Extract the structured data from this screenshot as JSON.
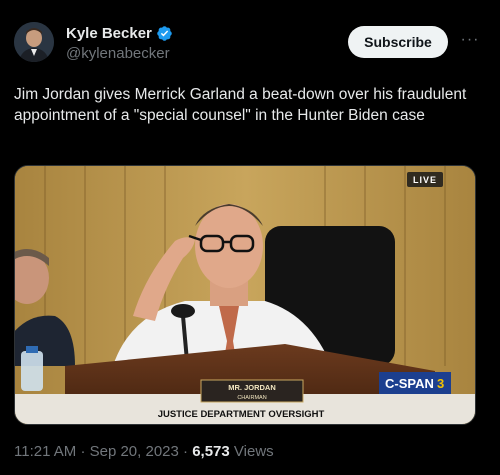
{
  "author": {
    "display_name": "Kyle Becker",
    "handle": "@kylenabecker"
  },
  "actions": {
    "subscribe_label": "Subscribe",
    "more_label": "···"
  },
  "tweet": {
    "text": "Jim Jordan gives Merrick Garland a beat-down over his fraudulent appointment of a \"special counsel\" in the Hunter Biden case"
  },
  "video": {
    "live_badge": "LIVE",
    "nameplate_line1": "MR. JORDAN",
    "nameplate_line2": "CHAIRMAN",
    "chyron": "JUSTICE DEPARTMENT OVERSIGHT",
    "network_logo_a": "C-SPAN",
    "network_logo_b": "3"
  },
  "meta": {
    "time": "11:21 AM",
    "date": "Sep 20, 2023",
    "views_count": "6,573",
    "views_label": "Views",
    "separator": "·"
  },
  "colors": {
    "verified": "#1d9bf0",
    "curtain": "#b8964d",
    "cspan_blue": "#1c3f8f",
    "cspan_yellow": "#f2c200"
  }
}
